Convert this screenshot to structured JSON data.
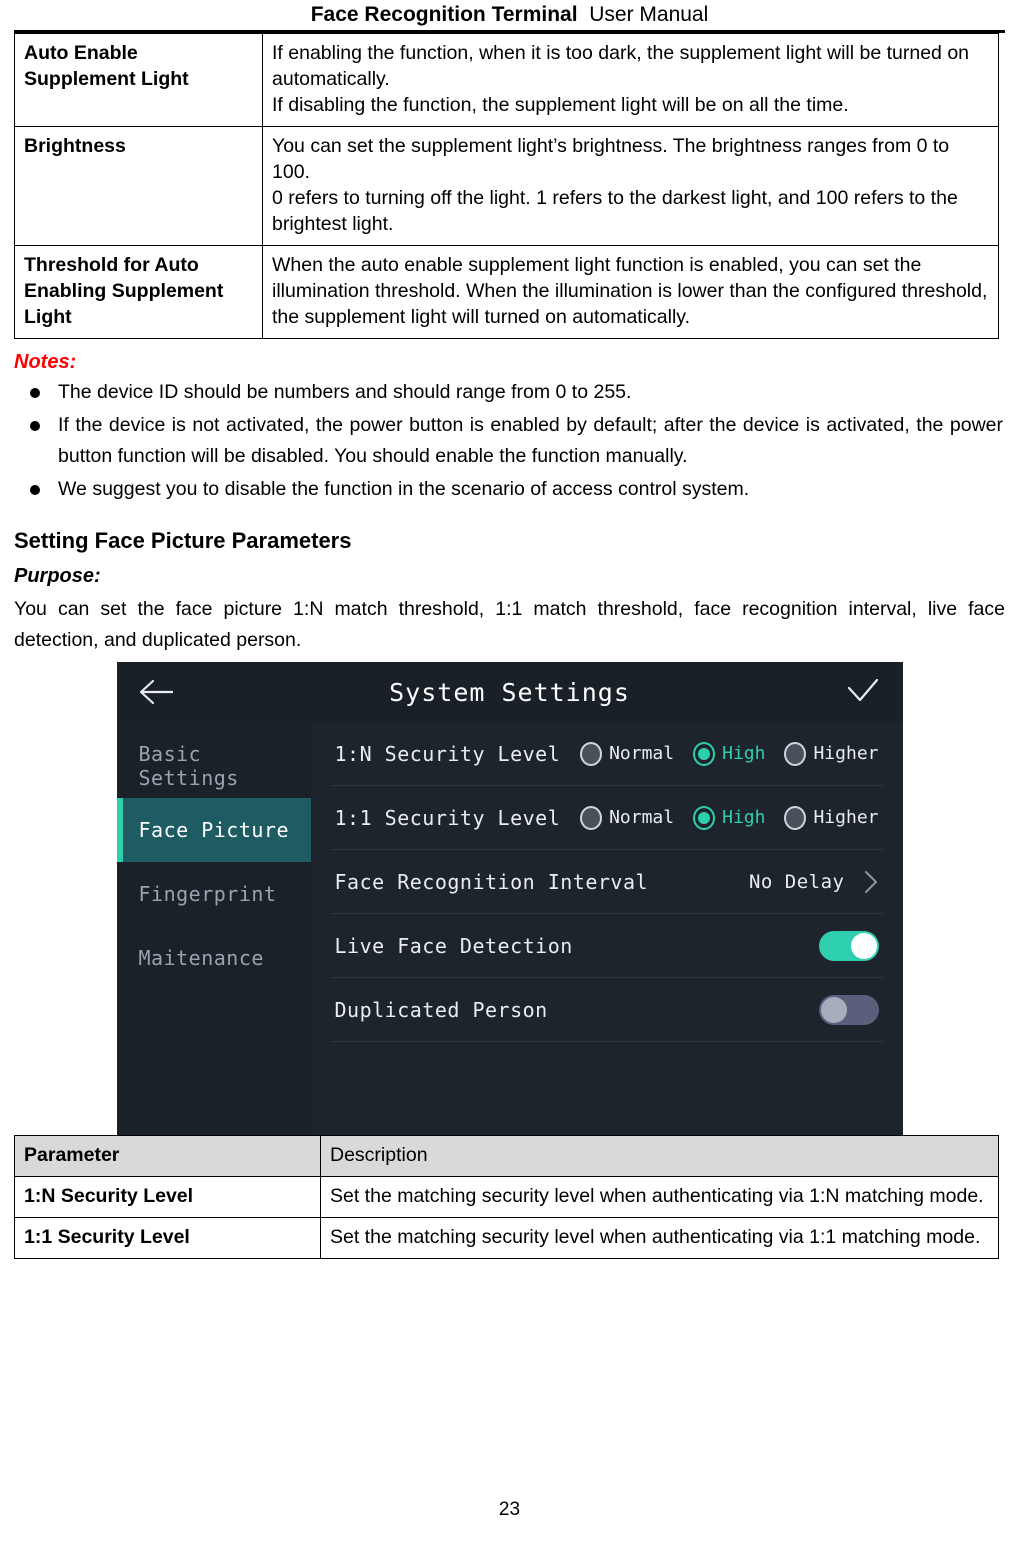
{
  "header": {
    "product": "Face Recognition Terminal",
    "doc_type": "User Manual"
  },
  "table_top": {
    "rows": [
      {
        "parameter": "Auto Enable Supplement Light",
        "param_line1": "Auto Enable",
        "param_line2": "Supplement Light",
        "desc_line1": "If enabling the function, when it is too dark, the supplement light will be turned on automatically.",
        "desc_line2": "If disabling the function, the supplement light will be on all the time."
      },
      {
        "parameter": "Brightness",
        "param_line1": "Brightness",
        "param_line2": "",
        "desc_line1": "You can set the supplement light’s brightness. The brightness ranges from 0 to 100.",
        "desc_line2": "0 refers to turning off the light. 1 refers to the darkest light, and 100 refers to the brightest light."
      },
      {
        "parameter": "Threshold for Auto Enabling Supplement Light",
        "param_line1": "Threshold for Auto",
        "param_line2": "Enabling Supplement",
        "param_line3": "Light",
        "desc_line1": "When the auto enable supplement light function is enabled, you can set the illumination threshold. When the illumination is lower than the configured threshold, the supplement light will turned on automatically.",
        "desc_line2": ""
      }
    ]
  },
  "notes": {
    "title": "Notes:",
    "items": [
      "The device ID should be numbers and should range from 0 to 255.",
      "If the device is not activated, the power button is enabled by default; after the device is activated, the power button function will be disabled. You should enable the function manually.",
      "We suggest you to disable the function in the scenario of access control system."
    ]
  },
  "section": {
    "title": "Setting Face Picture Parameters",
    "purpose_label": "Purpose:",
    "purpose_text": "You can set the face picture 1:N match threshold, 1:1 match threshold, face recognition interval, live face detection, and duplicated person."
  },
  "device": {
    "topbar": {
      "title": "System Settings",
      "back_icon": "arrow-left-icon",
      "confirm_icon": "check-icon"
    },
    "sidebar": {
      "items": [
        {
          "label": "Basic Settings",
          "active": false
        },
        {
          "label": "Face Picture",
          "active": true
        },
        {
          "label": "Fingerprint",
          "active": false
        },
        {
          "label": "Maitenance",
          "active": false
        }
      ]
    },
    "settings": [
      {
        "label": "1:N Security Level",
        "type": "radio-group",
        "options": [
          {
            "label": "Normal",
            "selected": false
          },
          {
            "label": "High",
            "selected": true
          },
          {
            "label": "Higher",
            "selected": false
          }
        ]
      },
      {
        "label": "1:1 Security Level",
        "type": "radio-group",
        "options": [
          {
            "label": "Normal",
            "selected": false
          },
          {
            "label": "High",
            "selected": true
          },
          {
            "label": "Higher",
            "selected": false
          }
        ]
      },
      {
        "label": "Face Recognition Interval",
        "type": "value-chevron",
        "value": "No Delay"
      },
      {
        "label": "Live Face Detection",
        "type": "toggle",
        "state": "on"
      },
      {
        "label": "Duplicated Person",
        "type": "toggle",
        "state": "off"
      }
    ],
    "colors": {
      "accent": "#2ecfae",
      "active_item_bg": "#1e5b63",
      "screen_bg": "#1d242c",
      "topbar_bg": "#1a2028",
      "toggle_off": "#5a607c"
    }
  },
  "table_bottom": {
    "headers": [
      "Parameter",
      "Description"
    ],
    "rows": [
      {
        "parameter": "1:N Security Level",
        "description": "Set the matching security level when authenticating via 1:N matching mode."
      },
      {
        "parameter": "1:1 Security Level",
        "description": "Set the matching security level when authenticating via 1:1 matching mode."
      }
    ]
  },
  "footer": {
    "page_number": "23"
  }
}
